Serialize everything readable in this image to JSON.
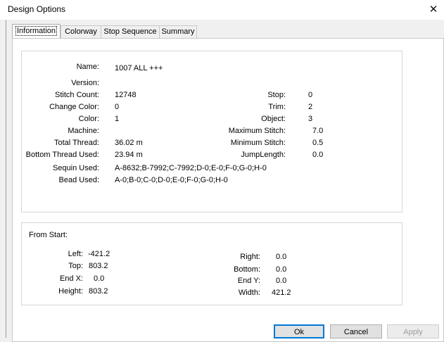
{
  "window": {
    "title": "Design Options",
    "close_glyph": "✕"
  },
  "tabs": [
    {
      "label": "Information"
    },
    {
      "label": "Colorway"
    },
    {
      "label": "Stop Sequence"
    },
    {
      "label": "Summary"
    }
  ],
  "info": {
    "name_label": "Name:",
    "name_value": "1007 ALL +++",
    "version_label": "Version:",
    "version_value": "",
    "stitch_count_label": "Stitch Count:",
    "stitch_count_value": "12748",
    "change_color_label": "Change Color:",
    "change_color_value": "0",
    "color_label": "Color:",
    "color_value": "1",
    "machine_label": "Machine:",
    "machine_value": "",
    "total_thread_label": "Total Thread:",
    "total_thread_value": "36.02 m",
    "bottom_thread_label": "Bottom Thread Used:",
    "bottom_thread_value": "23.94 m",
    "sequin_label": "Sequin Used:",
    "sequin_value": "A-8632;B-7992;C-7992;D-0;E-0;F-0;G-0;H-0",
    "bead_label": "Bead Used:",
    "bead_value": "A-0;B-0;C-0;D-0;E-0;F-0;G-0;H-0",
    "stop_label": "Stop:",
    "stop_value": "0",
    "trim_label": "Trim:",
    "trim_value": "2",
    "object_label": "Object:",
    "object_value": "3",
    "max_stitch_label": "Maximum Stitch:",
    "max_stitch_value": "7.0",
    "min_stitch_label": "Minimum Stitch:",
    "min_stitch_value": "0.5",
    "jump_length_label": "JumpLength:",
    "jump_length_value": "0.0"
  },
  "from_start": {
    "heading": "From Start:",
    "left_label": "Left:",
    "left_value": "-421.2",
    "top_label": "Top:",
    "top_value": "803.2",
    "endx_label": "End X:",
    "endx_value": "0.0",
    "height_label": "Height:",
    "height_value": "803.2",
    "right_label": "Right:",
    "right_value": "0.0",
    "bottom_label": "Bottom:",
    "bottom_value": "0.0",
    "endy_label": "End Y:",
    "endy_value": "0.0",
    "width_label": "Width:",
    "width_value": "421.2"
  },
  "buttons": {
    "ok": "Ok",
    "cancel": "Cancel",
    "apply": "Apply"
  }
}
